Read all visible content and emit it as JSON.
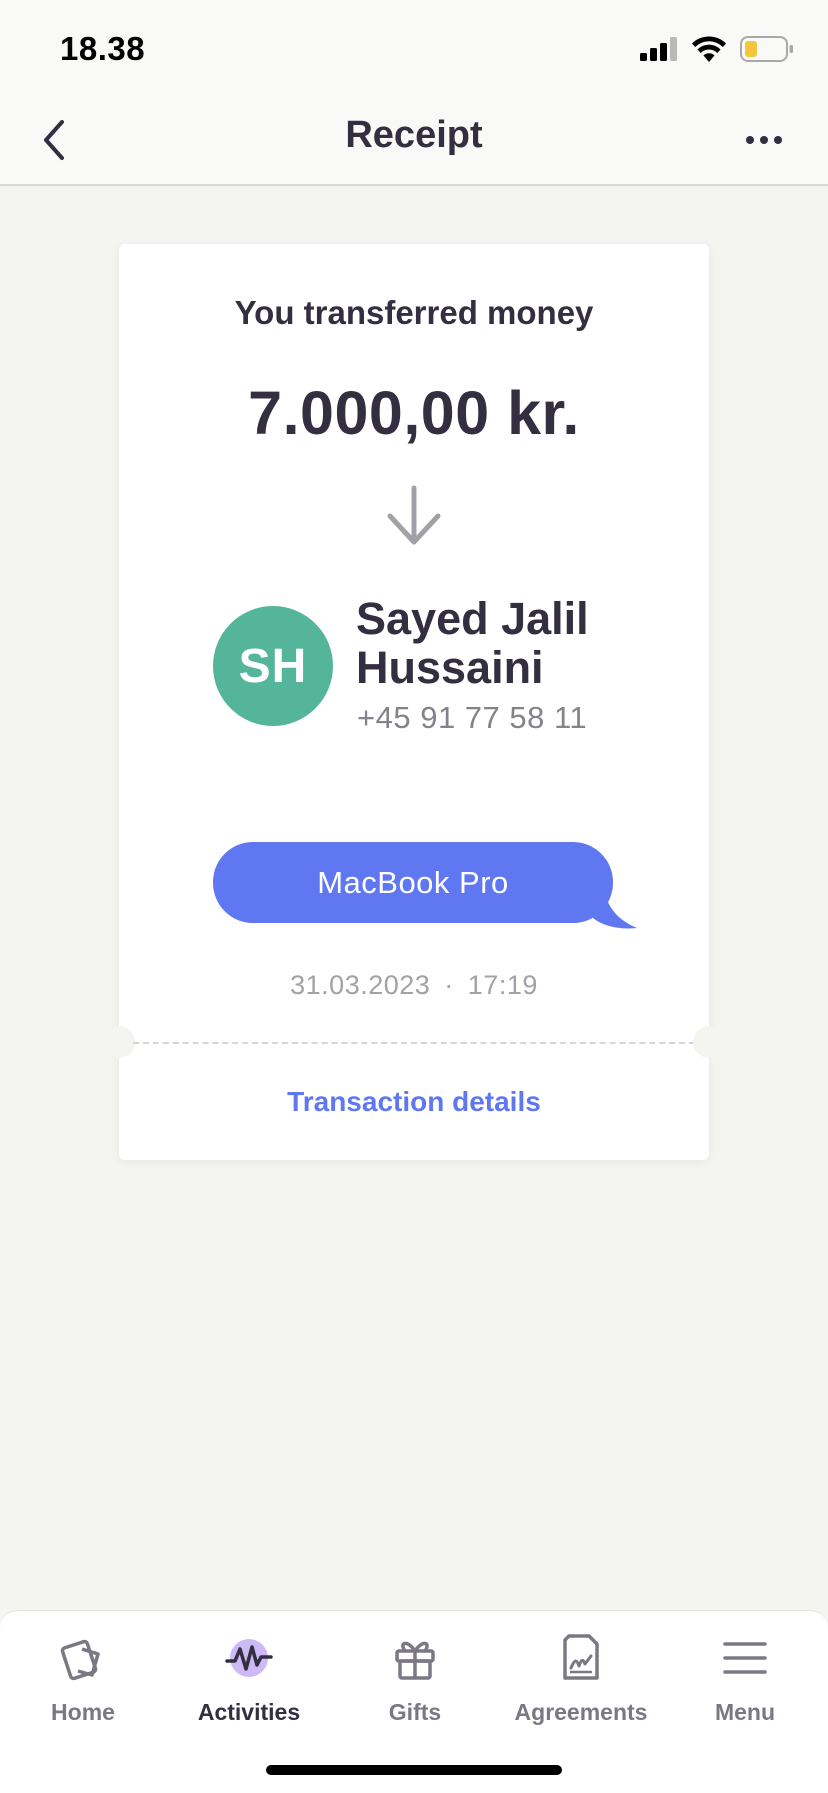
{
  "status_bar": {
    "time": "18.38",
    "icons": [
      "signal-icon",
      "wifi-icon",
      "battery-icon"
    ]
  },
  "nav": {
    "title": "Receipt",
    "back_icon": "chevron-left-icon",
    "more_icon": "more-horizontal-icon"
  },
  "receipt": {
    "heading": "You transferred money",
    "amount": "7.000,00 kr.",
    "direction_icon": "arrow-down-icon",
    "recipient": {
      "initials": "SH",
      "name": "Sayed Jalil Hussaini",
      "phone": "+45 91 77 58 11",
      "avatar_color": "#54b59b"
    },
    "message": "MacBook Pro",
    "date": "31.03.2023",
    "separator": "·",
    "time": "17:19",
    "details_link": "Transaction details"
  },
  "tab_bar": {
    "tabs": [
      {
        "label": "Home",
        "icon": "cards-icon",
        "active": false
      },
      {
        "label": "Activities",
        "icon": "activity-wave-icon",
        "active": true
      },
      {
        "label": "Gifts",
        "icon": "gift-icon",
        "active": false
      },
      {
        "label": "Agreements",
        "icon": "document-signature-icon",
        "active": false
      },
      {
        "label": "Menu",
        "icon": "hamburger-menu-icon",
        "active": false
      }
    ]
  },
  "colors": {
    "accent": "#5f78f2",
    "text_primary": "#342e41",
    "background": "#f4f4f1",
    "avatar": "#54b59b",
    "battery_low": "#f3c63b"
  }
}
